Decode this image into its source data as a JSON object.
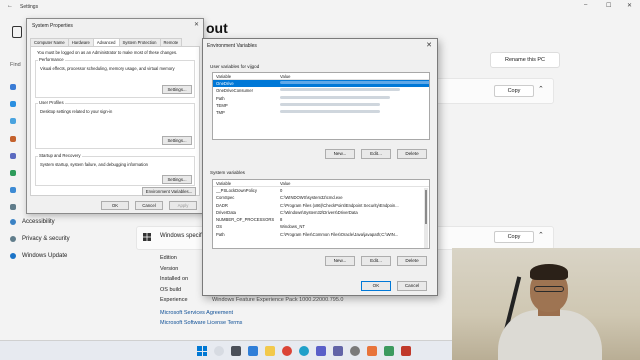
{
  "settings": {
    "app_title": "Settings",
    "find_placeholder": "Find",
    "page_heading_fragment": "out",
    "rename_button": "Rename this PC",
    "copy_button": "Copy",
    "sidebar": [
      {
        "label": "Accessibility",
        "icon": "accessibility-icon"
      },
      {
        "label": "Privacy & security",
        "icon": "shield-icon"
      },
      {
        "label": "Windows Update",
        "icon": "update-icon"
      }
    ],
    "windows_spec_label": "Windows specif",
    "specs": [
      "Edition",
      "Version",
      "Installed on",
      "OS build",
      "Experience"
    ],
    "experience_value": "Windows Feature Experience Pack 1000.22000.795.0",
    "links": [
      "Microsoft Services Agreement",
      "Microsoft Software License Terms"
    ]
  },
  "system_properties": {
    "title": "System Properties",
    "close": "✕",
    "tabs": [
      "Computer Name",
      "Hardware",
      "Advanced",
      "System Protection",
      "Remote"
    ],
    "active_tab": "Advanced",
    "admin_note": "You must be logged on as an Administrator to make most of these changes.",
    "groups": [
      {
        "title": "Performance",
        "text": "Visual effects, processor scheduling, memory usage, and virtual memory",
        "button": "Settings..."
      },
      {
        "title": "User Profiles",
        "text": "Desktop settings related to your sign-in",
        "button": "Settings..."
      },
      {
        "title": "Startup and Recovery",
        "text": "System startup, system failure, and debugging information",
        "button": "Settings..."
      }
    ],
    "env_button": "Environment Variables...",
    "ok": "OK",
    "cancel": "Cancel",
    "apply": "Apply"
  },
  "env_vars": {
    "title": "Environment Variables",
    "close": "✕",
    "user_section_label": "User variables for vijgod",
    "col_variable": "Variable",
    "col_value": "Value",
    "user_rows": [
      {
        "name": "OneDrive",
        "selected": true
      },
      {
        "name": "OneDriveConsumer",
        "selected": false
      },
      {
        "name": "Path",
        "selected": false
      },
      {
        "name": "TEMP",
        "selected": false
      },
      {
        "name": "TMP",
        "selected": false
      }
    ],
    "system_section_label": "System variables",
    "system_rows": [
      {
        "name": "__PSLockDownPolicy",
        "value": "0"
      },
      {
        "name": "ComSpec",
        "value": "C:\\WINDOWS\\system32\\cmd.exe"
      },
      {
        "name": "DADR",
        "value": "C:\\Program Files (x86)\\CheckPoint\\Endpoint Security\\Endpoin..."
      },
      {
        "name": "DriverData",
        "value": "C:\\Windows\\System32\\Drivers\\DriverData"
      },
      {
        "name": "NUMBER_OF_PROCESSORS",
        "value": "8"
      },
      {
        "name": "OS",
        "value": "Windows_NT"
      },
      {
        "name": "Path",
        "value": "C:\\Program Files\\Common Files\\Oracle\\Java\\javapath;C:\\WIN..."
      }
    ],
    "new_button": "New...",
    "edit_button": "Edit...",
    "delete_button": "Delete",
    "ok": "OK",
    "cancel": "Cancel"
  },
  "taskbar_icons": [
    "start-icon",
    "search-icon",
    "task-view-icon",
    "widgets-icon",
    "file-explorer-icon",
    "chrome-icon",
    "edge-icon",
    "store-icon",
    "teams-icon",
    "settings-icon",
    "app-icon"
  ],
  "colors": {
    "accent": "#0078d7",
    "link": "#0e4f96"
  }
}
